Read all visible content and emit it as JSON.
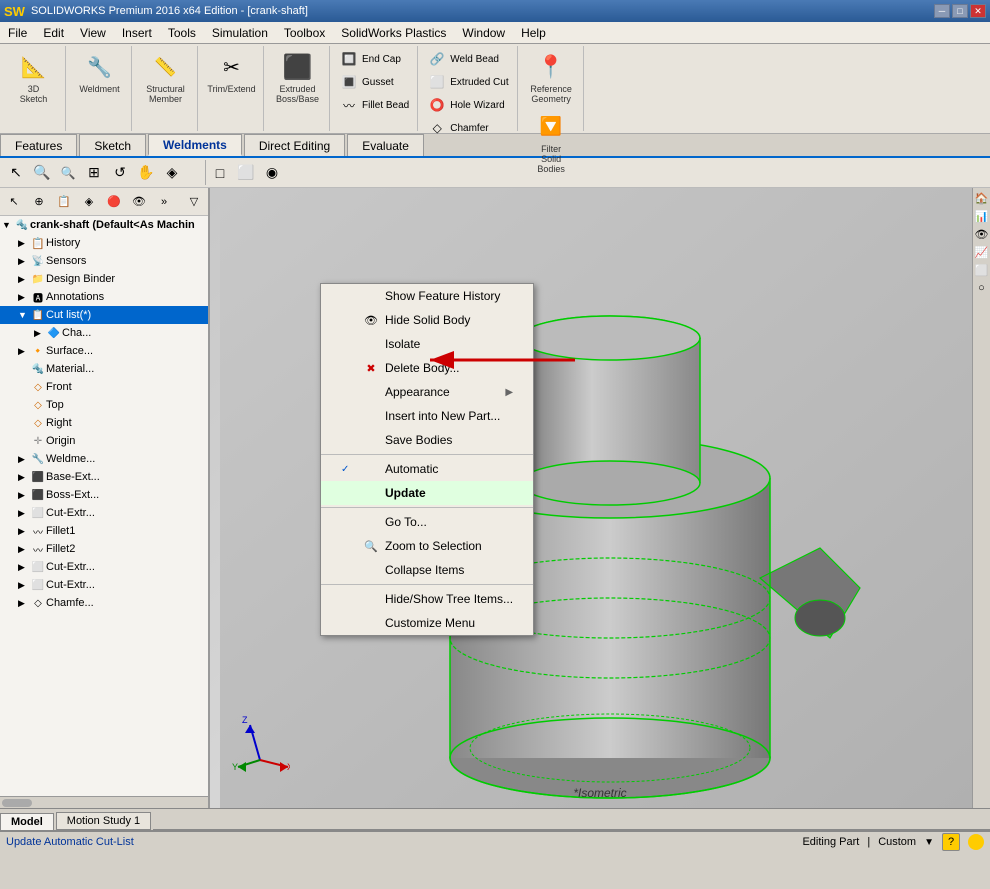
{
  "app": {
    "title": "SOLIDWORKS",
    "logo": "SW"
  },
  "titlebar": {
    "title": "SOLIDWORKS Premium 2016 x64 Edition - [crank-shaft]",
    "controls": [
      "─",
      "□",
      "✕"
    ]
  },
  "menubar": {
    "items": [
      "File",
      "Edit",
      "View",
      "Insert",
      "Tools",
      "Simulation",
      "Toolbox",
      "SolidWorks Plastics",
      "Window",
      "Help"
    ]
  },
  "ribbon": {
    "groups": [
      {
        "id": "sketch",
        "buttons": [
          {
            "label": "3D\nSketch",
            "icon": "📐"
          }
        ]
      },
      {
        "id": "weldment",
        "buttons": [
          {
            "label": "Weldment",
            "icon": "🔧"
          }
        ]
      },
      {
        "id": "structural",
        "buttons": [
          {
            "label": "Structural\nMember",
            "icon": "📏"
          }
        ]
      },
      {
        "id": "trim",
        "buttons": [
          {
            "label": "Trim/Extend",
            "icon": "✂"
          }
        ]
      },
      {
        "id": "extruded-boss",
        "buttons": [
          {
            "label": "Extruded\nBoss/Base",
            "icon": "⬛"
          }
        ]
      }
    ],
    "small_buttons": {
      "group1": [
        {
          "label": "End Cap",
          "icon": "🔲"
        },
        {
          "label": "Gusset",
          "icon": "🔳"
        },
        {
          "label": "Fillet Bead",
          "icon": "〰"
        }
      ],
      "group2": [
        {
          "label": "Weld Bead",
          "icon": "🔗"
        },
        {
          "label": "Extruded Cut",
          "icon": "⬜"
        },
        {
          "label": "Hole Wizard",
          "icon": "⭕"
        },
        {
          "label": "Chamfer",
          "icon": "◇"
        }
      ],
      "group3": [
        {
          "label": "Reference\nGeometry",
          "icon": "📍"
        },
        {
          "label": "Filter\nSolid\nBodies",
          "icon": "🔽"
        }
      ]
    }
  },
  "tabs": {
    "items": [
      "Features",
      "Sketch",
      "Weldments",
      "Direct Editing",
      "Evaluate"
    ],
    "active": "Weldments"
  },
  "tree": {
    "title": "crank-shaft (Default<As Machin",
    "items": [
      {
        "id": "history",
        "label": "History",
        "icon": "📋",
        "indent": 1,
        "expanded": false
      },
      {
        "id": "sensors",
        "label": "Sensors",
        "icon": "📡",
        "indent": 1,
        "expanded": false
      },
      {
        "id": "design-binder",
        "label": "Design Binder",
        "icon": "📁",
        "indent": 1,
        "expanded": false
      },
      {
        "id": "annotations",
        "label": "Annotations",
        "icon": "📝",
        "indent": 1,
        "expanded": false
      },
      {
        "id": "cut-list",
        "label": "Cut list(*)",
        "icon": "📋",
        "indent": 1,
        "expanded": true,
        "selected": true
      },
      {
        "id": "chamfer",
        "label": "Cha...",
        "icon": "🔷",
        "indent": 2,
        "expanded": false
      },
      {
        "id": "surface",
        "label": "Surface...",
        "icon": "🔸",
        "indent": 1,
        "expanded": false
      },
      {
        "id": "material",
        "label": "Material...",
        "icon": "🔩",
        "indent": 1,
        "expanded": false
      },
      {
        "id": "front",
        "label": "Front",
        "icon": "◻",
        "indent": 1,
        "expanded": false
      },
      {
        "id": "top",
        "label": "Top",
        "icon": "◻",
        "indent": 1,
        "expanded": false
      },
      {
        "id": "right",
        "label": "Right",
        "icon": "◻",
        "indent": 1,
        "expanded": false
      },
      {
        "id": "origin",
        "label": "Origin",
        "icon": "✛",
        "indent": 1,
        "expanded": false
      },
      {
        "id": "weldme",
        "label": "Weldme...",
        "icon": "🔧",
        "indent": 1,
        "expanded": false
      },
      {
        "id": "base-ext",
        "label": "Base-Ext...",
        "icon": "⬛",
        "indent": 1,
        "expanded": false
      },
      {
        "id": "boss-ext",
        "label": "Boss-Ext...",
        "icon": "⬛",
        "indent": 1,
        "expanded": false
      },
      {
        "id": "cut-extr1",
        "label": "Cut-Extr...",
        "icon": "⬜",
        "indent": 1,
        "expanded": false
      },
      {
        "id": "fillet1",
        "label": "Fillet1",
        "icon": "〰",
        "indent": 1,
        "expanded": false
      },
      {
        "id": "fillet2",
        "label": "Fillet2",
        "icon": "〰",
        "indent": 1,
        "expanded": false
      },
      {
        "id": "cut-extr2",
        "label": "Cut-Extr...",
        "icon": "⬜",
        "indent": 1,
        "expanded": false
      },
      {
        "id": "cut-extr3",
        "label": "Cut-Extr...",
        "icon": "⬜",
        "indent": 1,
        "expanded": false
      },
      {
        "id": "chamfe",
        "label": "Chamfe...",
        "icon": "◇",
        "indent": 1,
        "expanded": false
      }
    ]
  },
  "context_menu": {
    "items": [
      {
        "id": "show-feature-history",
        "label": "Show Feature History",
        "icon": "",
        "has_sub": false,
        "separator_after": false
      },
      {
        "id": "hide-solid-body",
        "label": "Hide Solid Body",
        "icon": "👁",
        "has_sub": false,
        "separator_after": false
      },
      {
        "id": "isolate",
        "label": "Isolate",
        "icon": "",
        "has_sub": false,
        "separator_after": false
      },
      {
        "id": "delete-body",
        "label": "Delete Body...",
        "icon": "✖",
        "has_sub": false,
        "separator_after": false
      },
      {
        "id": "appearance",
        "label": "Appearance",
        "icon": "",
        "has_sub": true,
        "separator_after": false
      },
      {
        "id": "insert-new-part",
        "label": "Insert into New Part...",
        "icon": "",
        "has_sub": false,
        "separator_after": false
      },
      {
        "id": "save-bodies",
        "label": "Save Bodies",
        "icon": "",
        "has_sub": false,
        "separator_after": true
      },
      {
        "id": "automatic",
        "label": "Automatic",
        "icon": "✓",
        "has_sub": false,
        "separator_after": false
      },
      {
        "id": "update",
        "label": "Update",
        "icon": "",
        "has_sub": false,
        "separator_after": true,
        "highlighted": true
      },
      {
        "id": "go-to",
        "label": "Go To...",
        "icon": "",
        "has_sub": false,
        "separator_after": false
      },
      {
        "id": "zoom-to-selection",
        "label": "Zoom to Selection",
        "icon": "🔍",
        "has_sub": false,
        "separator_after": false
      },
      {
        "id": "collapse-items",
        "label": "Collapse Items",
        "icon": "",
        "has_sub": false,
        "separator_after": true
      },
      {
        "id": "hide-show-tree",
        "label": "Hide/Show Tree Items...",
        "icon": "",
        "has_sub": false,
        "separator_after": false
      },
      {
        "id": "customize-menu",
        "label": "Customize Menu",
        "icon": "",
        "has_sub": false,
        "separator_after": false
      }
    ]
  },
  "bottom_tabs": {
    "items": [
      "Model",
      "Motion Study 1"
    ],
    "active": "Model"
  },
  "statusbar": {
    "left": "Update Automatic Cut-List",
    "middle": "Editing Part",
    "right": "Custom",
    "help_icon": "?"
  },
  "viewport": {
    "label": "*Isometric"
  },
  "right_sidebar": {
    "icons": [
      "🏠",
      "📊",
      "🏠",
      "📈",
      "🔲",
      "◻"
    ]
  }
}
